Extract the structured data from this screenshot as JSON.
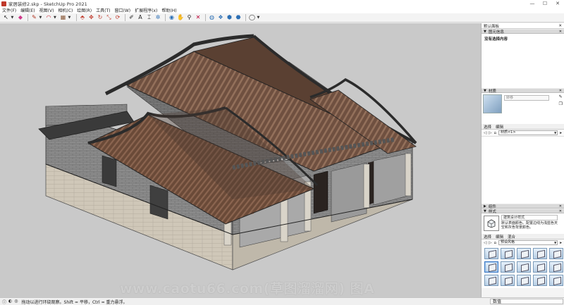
{
  "window": {
    "title": "家居装修2.skp - SketchUp Pro 2021",
    "controls": [
      "—",
      "☐",
      "✕"
    ]
  },
  "menu": [
    "文件(F)",
    "编辑(E)",
    "视图(V)",
    "相机(C)",
    "绘图(R)",
    "工具(T)",
    "窗口(W)",
    "扩展程序(x)",
    "帮助(H)"
  ],
  "toolbar": {
    "icons": [
      "arrow-select",
      "eraser",
      "pencil",
      "arc",
      "rectangle",
      "push-pull",
      "move",
      "rotate",
      "scale",
      "offset",
      "tape-measure",
      "text",
      "dimension",
      "axes",
      "orbit",
      "pan",
      "zoom",
      "zoom-extents",
      "sandbox-terrain",
      "geometry",
      "layers",
      "warehouse",
      "user"
    ]
  },
  "viewport": {
    "watermark": "www.caotu66.com(草图溜溜网) 图A"
  },
  "panel": {
    "header": "默认面板",
    "entity_info": {
      "title": "图元信息",
      "empty_text": "没有选择内容"
    },
    "materials": {
      "title": "材质",
      "name_placeholder": "转移",
      "tabs": [
        "选择",
        "编辑"
      ],
      "library": "材质<1>"
    },
    "components": {
      "title": "组件"
    },
    "styles": {
      "title": "样式",
      "name": "建筑设计样式",
      "description": "默认表面颜色。配置边线为浅蓝色天空和灰色背景颜色。",
      "tabs": [
        "选择",
        "编辑",
        "混合"
      ],
      "library": "预设风格",
      "thumb_count": 15,
      "selected_index": 5
    }
  },
  "statusbar": {
    "message": "拖动以进行环绕观察。Shift = 平移，Ctrl = 重力悬浮。",
    "measure_label": "数值"
  }
}
